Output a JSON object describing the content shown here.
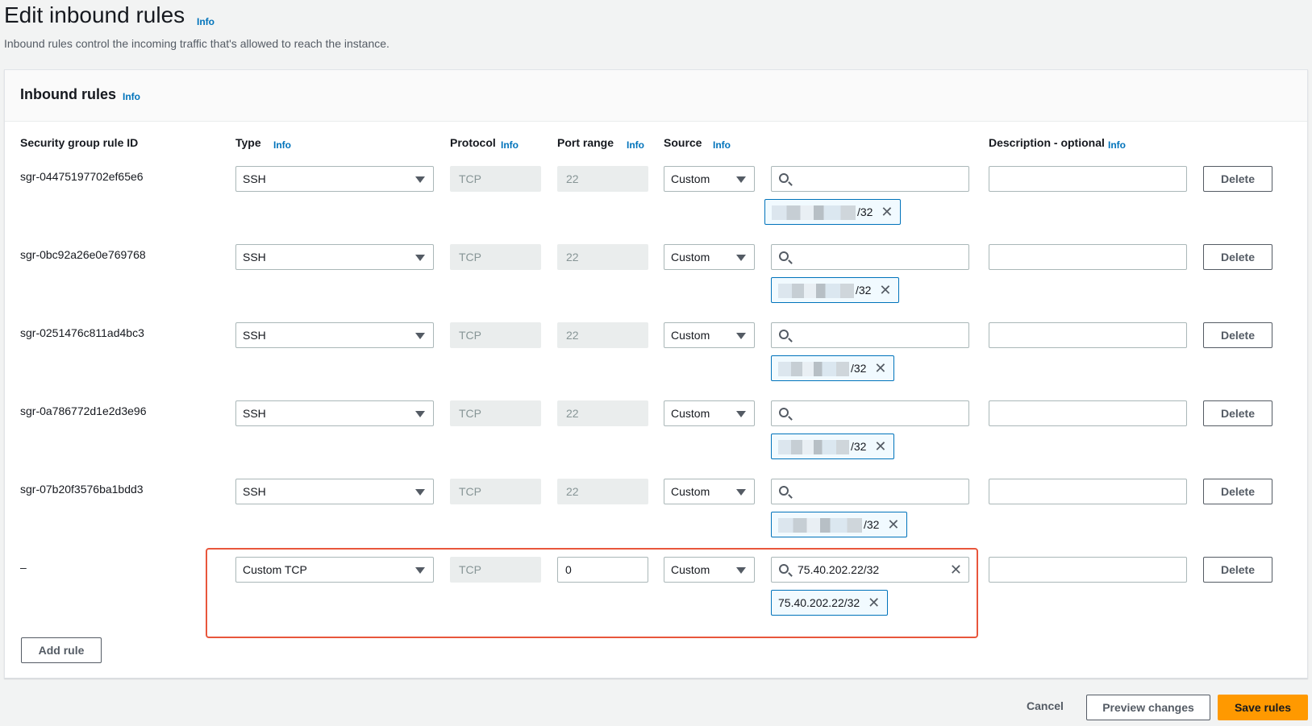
{
  "page": {
    "title": "Edit inbound rules",
    "title_info": "Info",
    "description": "Inbound rules control the incoming traffic that's allowed to reach the instance."
  },
  "panel": {
    "title": "Inbound rules",
    "title_info": "Info",
    "columns": {
      "rule_id": "Security group rule ID",
      "type": "Type",
      "protocol": "Protocol",
      "port_range": "Port range",
      "source": "Source",
      "description": "Description - optional",
      "info": "Info"
    }
  },
  "rules": [
    {
      "id": "sgr-04475197702ef65e6",
      "type": "SSH",
      "protocol": "TCP",
      "port": "22",
      "source": "Custom",
      "search": "",
      "token_suffix": "/32",
      "description": "",
      "delete": "Delete"
    },
    {
      "id": "sgr-0bc92a26e0e769768",
      "type": "SSH",
      "protocol": "TCP",
      "port": "22",
      "source": "Custom",
      "search": "",
      "token_suffix": "/32",
      "description": "",
      "delete": "Delete"
    },
    {
      "id": "sgr-0251476c811ad4bc3",
      "type": "SSH",
      "protocol": "TCP",
      "port": "22",
      "source": "Custom",
      "search": "",
      "token_suffix": "/32",
      "description": "",
      "delete": "Delete"
    },
    {
      "id": "sgr-0a786772d1e2d3e96",
      "type": "SSH",
      "protocol": "TCP",
      "port": "22",
      "source": "Custom",
      "search": "",
      "token_suffix": "/32",
      "description": "",
      "delete": "Delete"
    },
    {
      "id": "sgr-07b20f3576ba1bdd3",
      "type": "SSH",
      "protocol": "TCP",
      "port": "22",
      "source": "Custom",
      "search": "",
      "token_suffix": "/32",
      "description": "",
      "delete": "Delete"
    },
    {
      "id": "–",
      "type": "Custom TCP",
      "protocol": "TCP",
      "port": "0",
      "source": "Custom",
      "search": "75.40.202.22/32",
      "token": "75.40.202.22/32",
      "description": "",
      "delete": "Delete"
    }
  ],
  "actions": {
    "add_rule": "Add rule",
    "cancel": "Cancel",
    "preview": "Preview changes",
    "save": "Save rules"
  },
  "colors": {
    "accent": "#ff9900",
    "link": "#0073bb",
    "highlight": "#e8563c"
  }
}
